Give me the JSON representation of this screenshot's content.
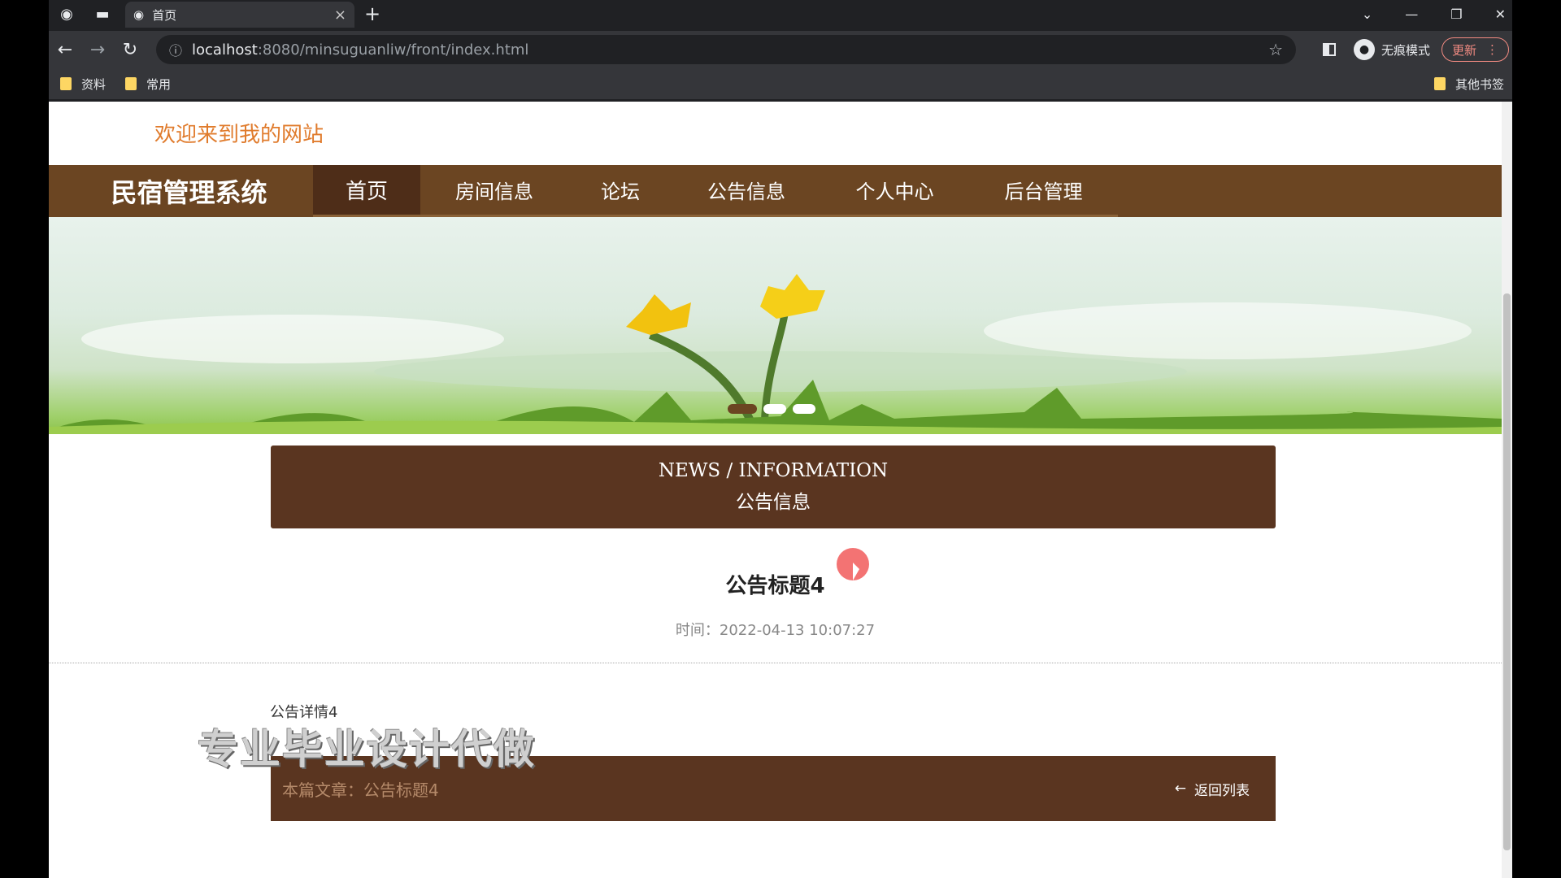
{
  "browser": {
    "tab_title": "首页",
    "tab_close": "×",
    "new_tab": "+",
    "url_host": "localhost",
    "url_path": ":8080/minsuguanliw/front/index.html",
    "incognito_label": "无痕模式",
    "update_label": "更新",
    "bookmarks": [
      "资料",
      "常用"
    ],
    "other_bookmarks": "其他书签"
  },
  "page": {
    "welcome": "欢迎来到我的网站",
    "brand": "民宿管理系统",
    "nav": [
      "首页",
      "房间信息",
      "论坛",
      "公告信息",
      "个人中心",
      "后台管理"
    ],
    "section_en": "NEWS / INFORMATION",
    "section_zh": "公告信息",
    "announcement_title": "公告标题4",
    "announcement_time": "时间：2022-04-13 10:07:27",
    "announcement_body": "公告详情4",
    "watermark": "专业毕业设计代做",
    "current_article": "本篇文章：公告标题4",
    "back_to_list": "返回列表"
  },
  "colors": {
    "nav_brown": "#6b4522",
    "dark_brown": "#5a3520",
    "welcome_orange": "#e07b2c"
  }
}
